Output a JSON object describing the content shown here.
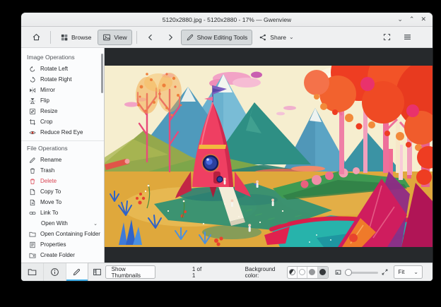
{
  "colors": {
    "accent": "#3daee9",
    "danger": "#da4453",
    "viewer_bg": "#26292c",
    "chrome_bg": "#eff0f1"
  },
  "window": {
    "title": "5120x2880.jpg - 5120x2880 - 17% — Gwenview",
    "minimize_glyph": "⌄",
    "maximize_glyph": "⌃",
    "close_glyph": "✕"
  },
  "icons": {
    "chevron_down": "⌄"
  },
  "toolbar": {
    "browse": "Browse",
    "view": "View",
    "show_editing_tools": "Show Editing Tools",
    "share": "Share"
  },
  "sidebar": {
    "sections": [
      {
        "title": "Image Operations",
        "items": [
          {
            "label": "Rotate Left"
          },
          {
            "label": "Rotate Right"
          },
          {
            "label": "Mirror"
          },
          {
            "label": "Flip"
          },
          {
            "label": "Resize"
          },
          {
            "label": "Crop"
          },
          {
            "label": "Reduce Red Eye"
          }
        ]
      },
      {
        "title": "File Operations",
        "items": [
          {
            "label": "Rename"
          },
          {
            "label": "Trash"
          },
          {
            "label": "Delete"
          },
          {
            "label": "Copy To"
          },
          {
            "label": "Move To"
          },
          {
            "label": "Link To"
          },
          {
            "label": "Open With"
          },
          {
            "label": "Open Containing Folder"
          },
          {
            "label": "Properties"
          },
          {
            "label": "Create Folder"
          }
        ]
      }
    ]
  },
  "statusbar": {
    "show_thumbnails": "Show Thumbnails",
    "page_indicator": "1 of 1",
    "background_color_label": "Background color:",
    "zoom_value": "Fit"
  }
}
